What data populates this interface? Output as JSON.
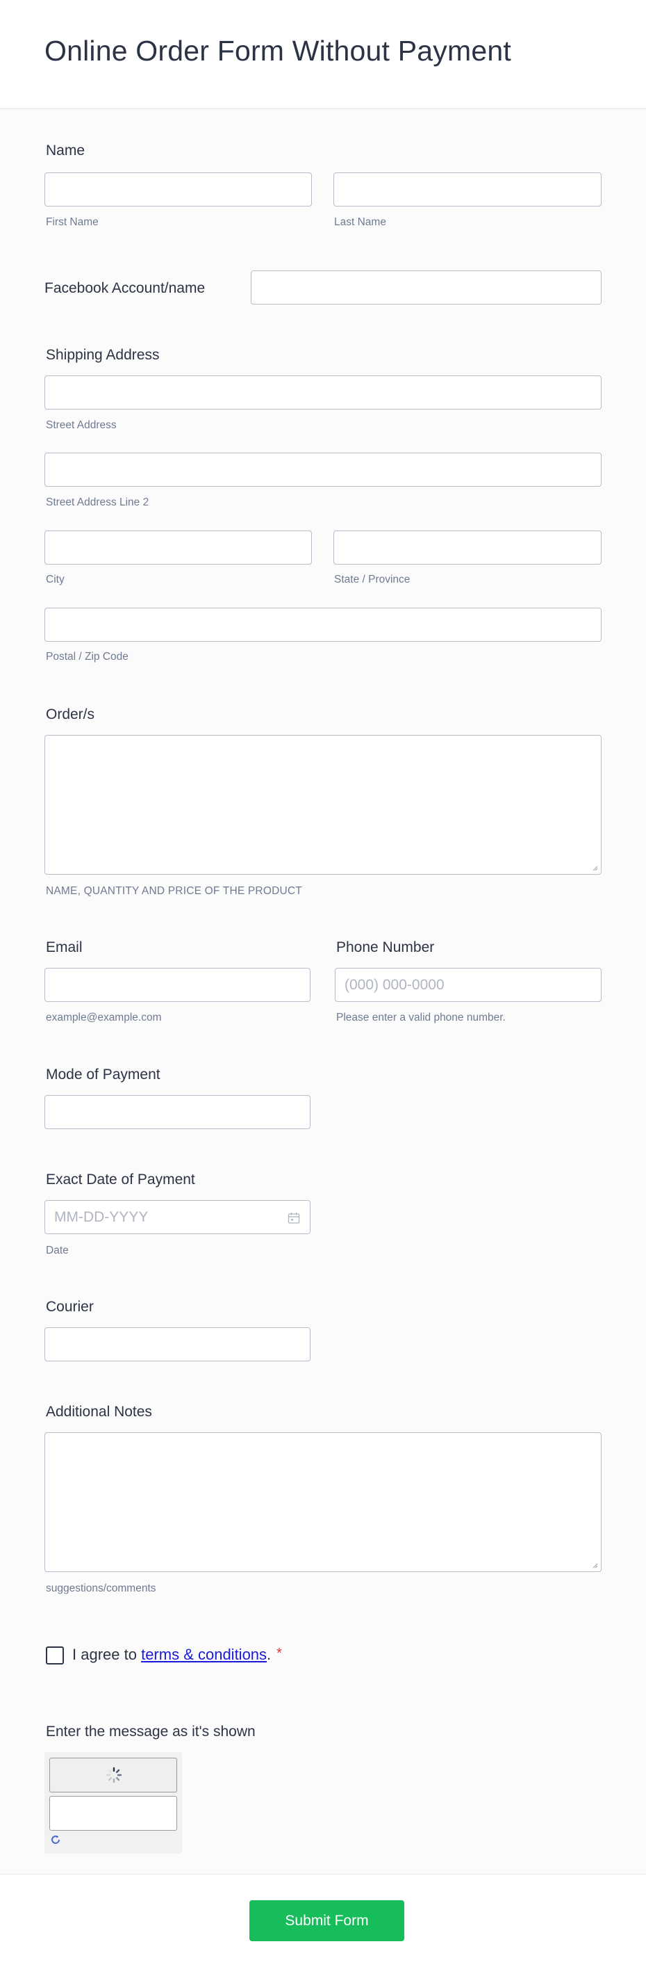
{
  "form": {
    "title": "Online Order Form Without Payment"
  },
  "fields": {
    "name": {
      "label": "Name",
      "first_sublabel": "First Name",
      "last_sublabel": "Last Name",
      "first_value": "",
      "last_value": ""
    },
    "facebook": {
      "label": "Facebook Account/name",
      "value": ""
    },
    "shipping": {
      "label": "Shipping Address",
      "street_sublabel": "Street Address",
      "street2_sublabel": "Street Address Line 2",
      "city_sublabel": "City",
      "state_sublabel": "State / Province",
      "postal_sublabel": "Postal / Zip Code"
    },
    "orders": {
      "label": "Order/s",
      "sublabel": "NAME, QUANTITY AND PRICE OF THE PRODUCT",
      "value": ""
    },
    "email": {
      "label": "Email",
      "sublabel": "example@example.com",
      "value": ""
    },
    "phone": {
      "label": "Phone Number",
      "placeholder": "(000) 000-0000",
      "sublabel": "Please enter a valid phone number."
    },
    "payment_mode": {
      "label": "Mode of Payment",
      "value": ""
    },
    "payment_date": {
      "label": "Exact Date of Payment",
      "placeholder": "MM-DD-YYYY",
      "sublabel": "Date",
      "icon": "calendar-icon"
    },
    "courier": {
      "label": "Courier",
      "value": ""
    },
    "notes": {
      "label": "Additional Notes",
      "sublabel": "suggestions/comments",
      "value": ""
    },
    "terms": {
      "prefix": "I agree to ",
      "link": "terms & conditions",
      "suffix": ".",
      "required_mark": "*",
      "checked": false
    },
    "captcha": {
      "label": "Enter the message as it's shown",
      "value": "",
      "icons": [
        "loading-spinner-icon",
        "refresh-icon"
      ]
    }
  },
  "submit": {
    "label": "Submit Form"
  },
  "colors": {
    "accent": "#18bd5b",
    "text": "#2c3345",
    "sublabel": "#6f7a91",
    "border": "#b8bdc9",
    "link": "#1a1adb",
    "required": "#e03131"
  }
}
